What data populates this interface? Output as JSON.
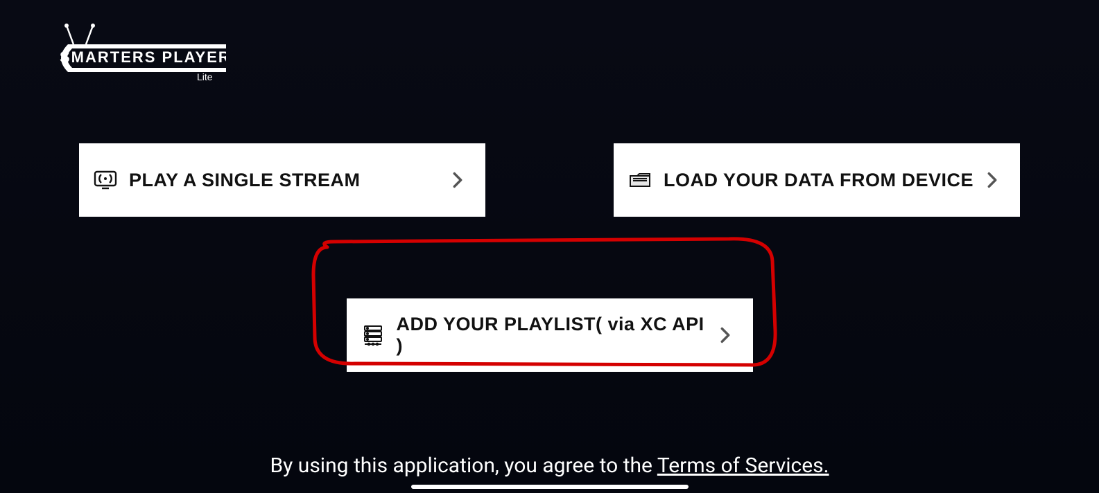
{
  "app": {
    "name": "SMARTERS PLAYER",
    "sub": "Lite"
  },
  "options": {
    "single_stream": "PLAY A SINGLE STREAM",
    "load_device": "LOAD YOUR DATA FROM DEVICE",
    "add_playlist": "ADD YOUR PLAYLIST( via XC API )"
  },
  "footer": {
    "prefix": "By using this application, you agree to the ",
    "terms": "Terms of Services."
  }
}
